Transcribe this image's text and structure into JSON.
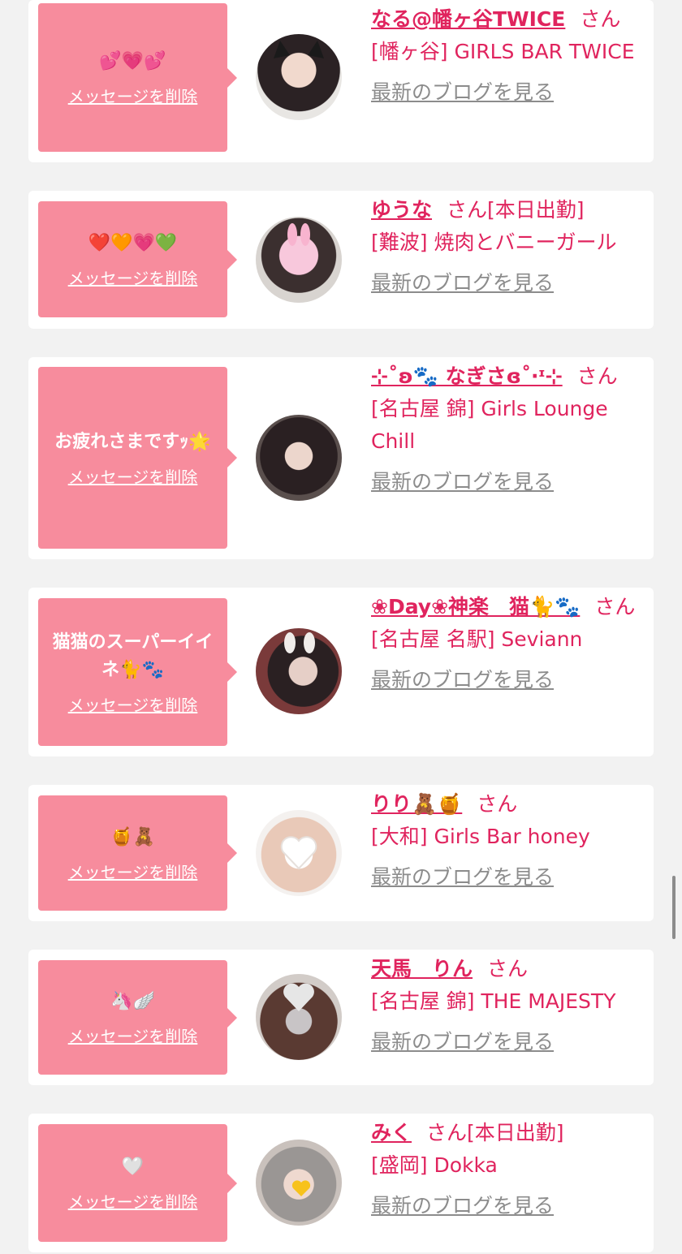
{
  "delete_label": "メッセージを削除",
  "blog_label": "最新のブログを見る",
  "suffix_san": "さん",
  "colors": {
    "accent": "#e0245e",
    "bubble": "#f78c9d",
    "background": "#f2f2f2"
  },
  "cards": [
    {
      "message": "💕💗💕",
      "name": "なる@幡ヶ谷TWICE",
      "status": "",
      "shop": "[幡ヶ谷] GIRLS BAR TWICE",
      "avatar_icon": "cat-ear-girl-avatar"
    },
    {
      "message": "❤️🧡💗💚",
      "name": "ゆうな",
      "status": "[本日出勤]",
      "shop": "[難波] 焼肉とバニーガール",
      "avatar_icon": "bunny-sticker-avatar"
    },
    {
      "message": "お疲れさまですｯ🌟",
      "name": "⊹˚ʚ🐾 なぎさɞ˚‧ᶦ⊹",
      "status": "",
      "shop": "[名古屋 錦] Girls Lounge Chill",
      "avatar_icon": "girl-avatar"
    },
    {
      "message": "猫猫のスーパーイイネ🐈🐾",
      "name": "❀Day❀神楽　猫🐈🐾",
      "status": "",
      "shop": "[名古屋 名駅] Seviann",
      "avatar_icon": "bunny-ear-girl-avatar"
    },
    {
      "message": "🍯🧸",
      "name": "りり🧸🍯",
      "status": "",
      "shop": "[大和] Girls Bar honey",
      "avatar_icon": "heart-sticker-avatar"
    },
    {
      "message": "🦄🪽",
      "name": "天馬　りん",
      "status": "",
      "shop": "[名古屋 錦] THE MAJESTY",
      "avatar_icon": "curly-hair-avatar"
    },
    {
      "message": "🤍",
      "name": "みく",
      "status": "[本日出勤]",
      "shop": "[盛岡] Dokka",
      "avatar_icon": "heart-face-avatar"
    }
  ]
}
